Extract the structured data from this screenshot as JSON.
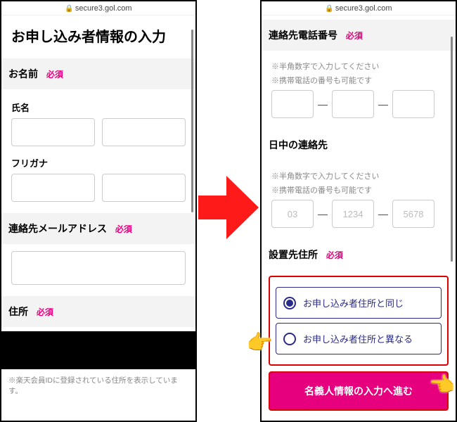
{
  "url": "secure3.gol.com",
  "left": {
    "page_title": "お申し込み者情報の入力",
    "name_section": {
      "header": "お名前",
      "required": "必須"
    },
    "shimei_label": "氏名",
    "furigana_label": "フリガナ",
    "email_section": {
      "header": "連絡先メールアドレス",
      "required": "必須"
    },
    "address_section": {
      "header": "住所",
      "required": "必須"
    },
    "footnote": "※楽天会員IDに登録されている住所を表示しています。"
  },
  "right": {
    "tel_section": {
      "header": "連絡先電話番号",
      "required": "必須"
    },
    "tel_hint1": "※半角数字で入力してください",
    "tel_hint2": "※携帯電話の番号も可能です",
    "daytime_section": {
      "header": "日中の連絡先"
    },
    "day_hint1": "※半角数字で入力してください",
    "day_hint2": "※携帯電話の番号も可能です",
    "day_ph": {
      "a": "03",
      "b": "1234",
      "c": "5678"
    },
    "install_section": {
      "header": "設置先住所",
      "required": "必須"
    },
    "radio_same": "お申し込み者住所と同じ",
    "radio_diff": "お申し込み者住所と異なる",
    "cta": "名義人情報の入力へ進む"
  },
  "dash": "—"
}
